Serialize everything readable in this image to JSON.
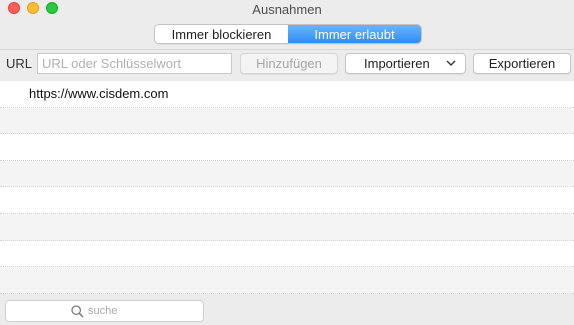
{
  "window": {
    "title": "Ausnahmen"
  },
  "tabs": [
    {
      "label": "Immer blockieren",
      "selected": false
    },
    {
      "label": "Immer erlaubt",
      "selected": true
    }
  ],
  "toolbar": {
    "url_label": "URL",
    "url_placeholder": "URL oder Schlüsselwort",
    "url_value": "",
    "add_label": "Hinzufügen",
    "import_label": "Importieren",
    "export_label": "Exportieren"
  },
  "list": {
    "items": [
      "https://www.cisdem.com",
      "",
      "",
      "",
      "",
      "",
      "",
      ""
    ]
  },
  "search": {
    "placeholder": "suche",
    "value": ""
  },
  "colors": {
    "accent": "#2f8ef6",
    "close": "#fd5f57",
    "minimize": "#febc2e",
    "maximize": "#28c840"
  }
}
